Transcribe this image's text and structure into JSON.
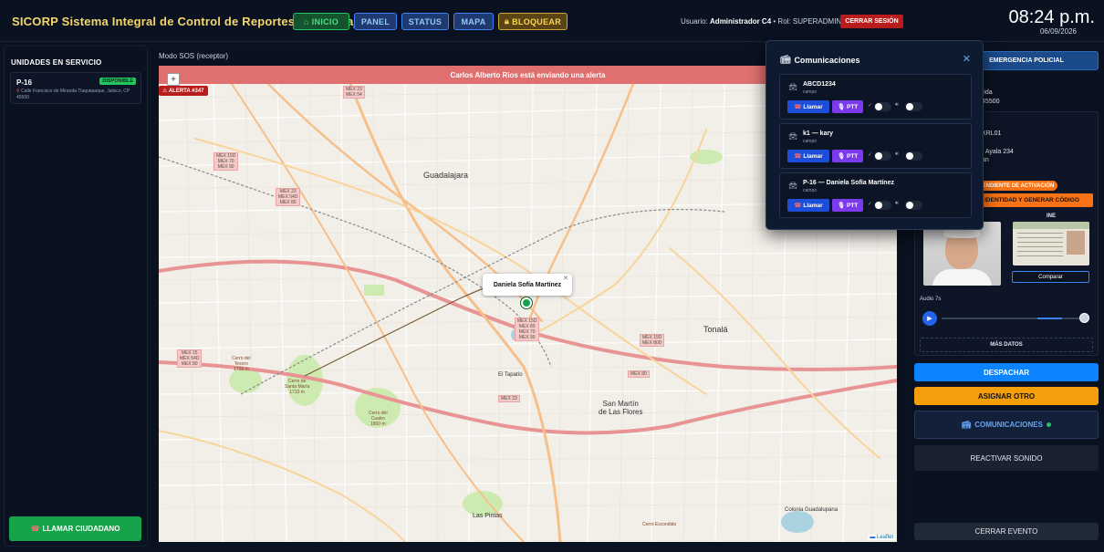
{
  "header": {
    "title": "SICORP Sistema Integral de Control de Reportes y Patrullaje",
    "nav": {
      "inicio": "INICIO",
      "panel": "PANEL",
      "status": "STATUS",
      "mapa": "MAPA",
      "bloquear": "BLOQUEAR"
    },
    "user_prefix": "Usuario:",
    "user_name": "Administrador C4",
    "role": "• Rol: SUPERADMIN",
    "logout": "CERRAR SESIÓN",
    "time": "08:24 p.m.",
    "date": "06/09/2026"
  },
  "left_panel": {
    "title": "UNIDADES EN SERVICIO",
    "unit": {
      "id": "P-16",
      "status": "DISPONIBLE",
      "address": "Calle Francisco de Miranda Tlaquepaque, Jalisco, CP 45500"
    },
    "call_citizen": "LLAMAR CIUDADANO"
  },
  "map": {
    "mode_label": "Modo SOS (receptor)",
    "alert_banner": "Carlos Alberto Rios está enviando una alerta",
    "alert_tag": "ALERTA #347",
    "popup_name": "Daniela Sofía Martínez",
    "attribution": "Leaflet",
    "labels": {
      "guadalajara": "Guadalajara",
      "tonala": "Tonalá",
      "san_martin": "San Martín\nde Las Flores",
      "el_tapatio": "El Tapatío",
      "las_pintas": "Las Pintas",
      "colonia_guadalupana": "Colonia Guadalupana",
      "cerro_tesoro": "Cerro del\nTesoro\n1728 m",
      "cerro_santa_maria": "Cerro de\nSanta María\n1710 m",
      "cerro_cuatro": "Cerro del\nCuatro\n1860 m",
      "cerro_escondido": "Cerro Escondido",
      "shield_1": "MEX 15D\nMEX 70\nMEX 90",
      "shield_2": "MEX 23\nMEX 54D\nMEX 80",
      "shield_3": "MEX 15D\nMEX 80\nMEX 70\nMEX 90",
      "shield_4": "MEX 15D\nMEX 80D",
      "shield_5": "MEX 15\nMEX 54D\nMEX 80",
      "shield_6": "MEX 23",
      "shield_7": "MEX 80",
      "shield_8": "MEX 23\nMEX 54"
    }
  },
  "comms_popup": {
    "title": "Comunicaciones",
    "call_label": "Llamar",
    "ptt_label": "PTT",
    "contacts": [
      {
        "name": "ABCD1234",
        "sub": "campo"
      },
      {
        "name": "k1 — kary",
        "sub": "campo"
      },
      {
        "name": "P-16 — Daniela Sofía Martínez",
        "sub": "campo"
      }
    ]
  },
  "right_panel": {
    "emergency_tab": "EMERGENCIA POLICIAL",
    "partial_1": "rida",
    "partial_2": "45500",
    "partial_3": "XRL01",
    "partial_4": "r Ayala 234",
    "partial_5": "an",
    "pending_badge": "PENDIENTE DE ACTIVACIÓN",
    "verify_button": "IDENTIDAD Y GENERAR CÓDIGO",
    "ine_label": "INE",
    "compare": "Comparar",
    "audio_label": "Audio 7s",
    "audio_progress": 0.85,
    "more_data": "MÁS DATOS",
    "dispatch": "DESPACHAR",
    "assign_other": "ASIGNAR OTRO",
    "communications": "COMUNICACIONES",
    "reactivate_sound": "REACTIVAR SONIDO",
    "close_event": "CERRAR EVENTO"
  },
  "colors": {
    "accent": "#0a84ff",
    "title": "#f5d66b",
    "alert": "#e07070",
    "ok": "#22c55e"
  }
}
